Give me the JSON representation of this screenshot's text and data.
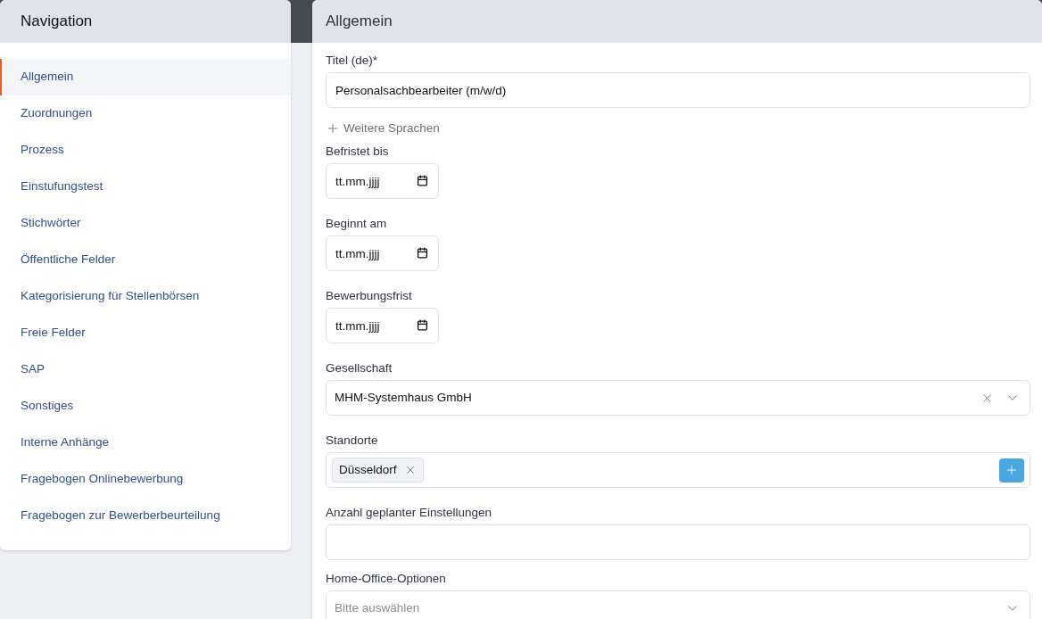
{
  "navigation": {
    "title": "Navigation",
    "items": [
      {
        "label": "Allgemein",
        "selected": true
      },
      {
        "label": "Zuordnungen",
        "selected": false
      },
      {
        "label": "Prozess",
        "selected": false
      },
      {
        "label": "Einstufungstest",
        "selected": false
      },
      {
        "label": "Stichwörter",
        "selected": false
      },
      {
        "label": "Öffentliche Felder",
        "selected": false
      },
      {
        "label": "Kategorisierung für Stellenbörsen",
        "selected": false
      },
      {
        "label": "Freie Felder",
        "selected": false
      },
      {
        "label": "SAP",
        "selected": false
      },
      {
        "label": "Sonstiges",
        "selected": false
      },
      {
        "label": "Interne Anhänge",
        "selected": false
      },
      {
        "label": "Fragebogen Onlinebewerbung",
        "selected": false
      },
      {
        "label": "Fragebogen zur Bewerberbeurteilung",
        "selected": false
      }
    ]
  },
  "form": {
    "title": "Allgemein",
    "fields": [
      {
        "kind": "text",
        "label": "Titel (de)*",
        "value": "Personalsachbearbeiter (m/w/d)"
      },
      {
        "kind": "link",
        "label": "Weitere Sprachen"
      },
      {
        "kind": "date",
        "label": "Befristet bis",
        "placeholder": "tt.mm.jjjj"
      },
      {
        "kind": "date",
        "label": "Beginnt am",
        "placeholder": "tt.mm.jjjj"
      },
      {
        "kind": "date",
        "label": "Bewerbungsfrist",
        "placeholder": "tt.mm.jjjj"
      },
      {
        "kind": "select",
        "label": "Gesellschaft",
        "value": "MHM-Systemhaus GmbH"
      },
      {
        "kind": "tags",
        "label": "Standorte",
        "tags": [
          "Düsseldorf"
        ]
      },
      {
        "kind": "text",
        "label": "Anzahl geplanter Einstellungen"
      },
      {
        "kind": "select",
        "label": "Home-Office-Optionen",
        "placeholder": "Bitte auswählen"
      }
    ]
  }
}
